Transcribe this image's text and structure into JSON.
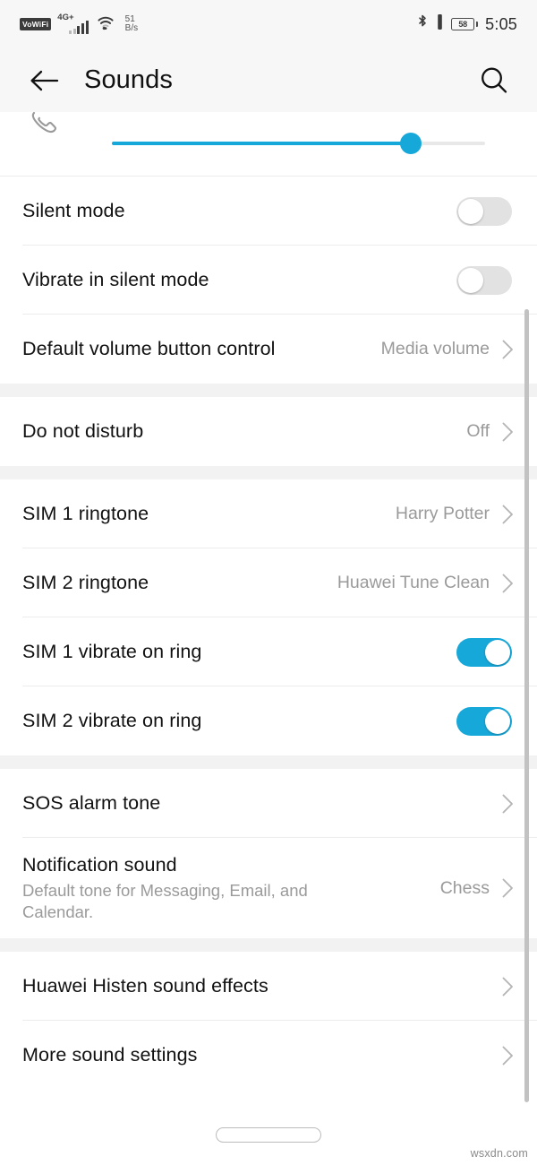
{
  "status_bar": {
    "vowifi_badge": "VoWiFi",
    "network_type": "4G+",
    "data_rate_value": "51",
    "data_rate_unit": "B/s",
    "signal_icon": "signal-bars-icon",
    "wifi_icon": "wifi-icon",
    "bluetooth_icon": "bluetooth-icon",
    "vibrate_icon": "vibrate-icon",
    "battery_percent": "58",
    "time": "5:05"
  },
  "header": {
    "back_icon": "back-arrow-icon",
    "title": "Sounds",
    "search_icon": "search-icon"
  },
  "colors": {
    "accent": "#17a8da",
    "header_bg": "#f7f7f7",
    "section_gap": "#f2f2f2",
    "divider": "#ececec",
    "toggle_off": "#e2e2e2",
    "value_text": "#9a9a9a",
    "scrollbar": "#c2c2c2"
  },
  "volume_slider": {
    "icon": "phone-call-icon",
    "value_percent": 80,
    "min": 0,
    "max": 100
  },
  "sections": [
    {
      "id": "section-modes",
      "rows": [
        {
          "id": "silent-mode",
          "label": "Silent mode",
          "control": "toggle",
          "state": "off"
        },
        {
          "id": "vibrate-in-silent-mode",
          "label": "Vibrate in silent mode",
          "control": "toggle",
          "state": "off"
        },
        {
          "id": "default-volume-button-control",
          "label": "Default volume button control",
          "control": "value",
          "value": "Media volume"
        }
      ]
    },
    {
      "id": "section-dnd",
      "rows": [
        {
          "id": "do-not-disturb",
          "label": "Do not disturb",
          "control": "value",
          "value": "Off"
        }
      ]
    },
    {
      "id": "section-sim",
      "rows": [
        {
          "id": "sim-1-ringtone",
          "label": "SIM 1 ringtone",
          "control": "value",
          "value": "Harry Potter"
        },
        {
          "id": "sim-2-ringtone",
          "label": "SIM 2 ringtone",
          "control": "value",
          "value": "Huawei Tune Clean"
        },
        {
          "id": "sim-1-vibrate-on-ring",
          "label": "SIM 1 vibrate on ring",
          "control": "toggle",
          "state": "on"
        },
        {
          "id": "sim-2-vibrate-on-ring",
          "label": "SIM 2 vibrate on ring",
          "control": "toggle",
          "state": "on"
        }
      ]
    },
    {
      "id": "section-tones",
      "rows": [
        {
          "id": "sos-alarm-tone",
          "label": "SOS alarm tone",
          "control": "chevron",
          "value": ""
        },
        {
          "id": "notification-sound",
          "label": "Notification sound",
          "sublabel": "Default tone for Messaging, Email, and Calendar.",
          "control": "value",
          "value": "Chess"
        }
      ]
    },
    {
      "id": "section-more",
      "rows": [
        {
          "id": "huawei-histen-sound-effects",
          "label": "Huawei Histen sound effects",
          "control": "chevron",
          "value": ""
        },
        {
          "id": "more-sound-settings",
          "label": "More sound settings",
          "control": "chevron",
          "value": ""
        }
      ]
    }
  ],
  "navbar": {
    "gesture_pill": "home-gesture-pill"
  },
  "watermark": {
    "text": "wsxdn.com"
  }
}
